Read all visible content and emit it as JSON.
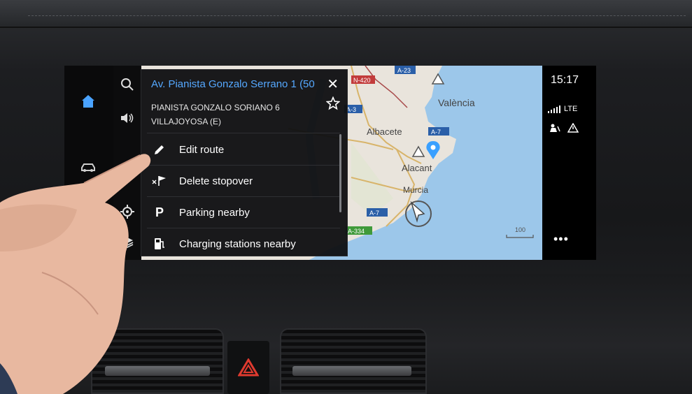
{
  "popup": {
    "title": "Av. Pianista Gonzalo Serrano 1 (50",
    "address_line1": "PIANISTA GONZALO SORIANO 6",
    "address_line2": "VILLAJOYOSA (E)",
    "menu": [
      {
        "label": "Edit route",
        "icon": "pencil-icon"
      },
      {
        "label": "Delete stopover",
        "icon": "delete-flag-icon"
      },
      {
        "label": "Parking nearby",
        "icon": "parking-icon"
      },
      {
        "label": "Charging stations nearby",
        "icon": "charging-station-icon"
      }
    ]
  },
  "status": {
    "time": "15:17",
    "network": "LTE"
  },
  "map": {
    "cities": [
      "València",
      "Albacete",
      "Alacant",
      "Murcia"
    ],
    "roads": [
      "N-420",
      "A-23",
      "A-3",
      "A-7",
      "A-7",
      "A-334"
    ],
    "scale_label": "100"
  },
  "colors": {
    "accent": "#55a8ff",
    "sea": "#9cc7ea",
    "land": "#e9e4dc",
    "road_label_bg": "#2b5fa8"
  }
}
